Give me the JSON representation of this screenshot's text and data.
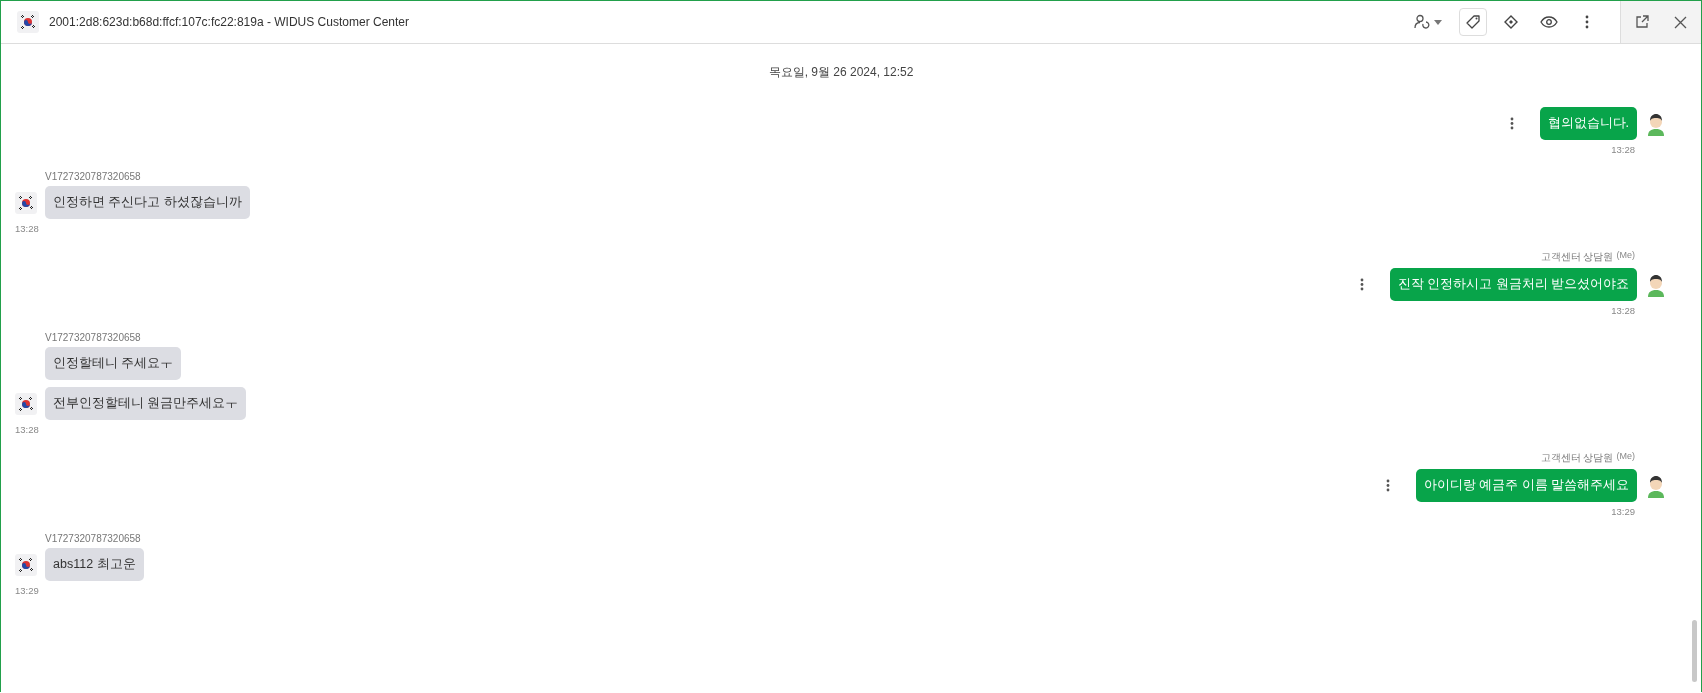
{
  "header": {
    "title": "2001:2d8:623d:b68d:ffcf:107c:fc22:819a - WIDUS Customer Center"
  },
  "date_divider": "목요일, 9월 26 2024, 12:52",
  "messages": [
    {
      "kind": "agent",
      "texts": [
        "협의없습니다."
      ],
      "time": "13:28"
    },
    {
      "kind": "customer",
      "sender": "V1727320787320658",
      "texts": [
        "인정하면 주신다고 하셨잖습니까"
      ],
      "time": "13:28"
    },
    {
      "kind": "agent",
      "sender": "고객센터 상담원",
      "sender_tag": "(Me)",
      "texts": [
        "진작 인정하시고 원금처리 받으셨어야죠"
      ],
      "time": "13:28"
    },
    {
      "kind": "customer",
      "sender": "V1727320787320658",
      "texts": [
        "인정할테니 주세요ㅜ",
        "전부인정할테니 원금만주세요ㅜ"
      ],
      "time": "13:28"
    },
    {
      "kind": "agent",
      "sender": "고객센터 상담원",
      "sender_tag": "(Me)",
      "texts": [
        "아이디랑 예금주 이름 말씀해주세요"
      ],
      "time": "13:29"
    },
    {
      "kind": "customer",
      "sender": "V1727320787320658",
      "texts": [
        "abs112 최고운"
      ],
      "time": "13:29"
    }
  ]
}
